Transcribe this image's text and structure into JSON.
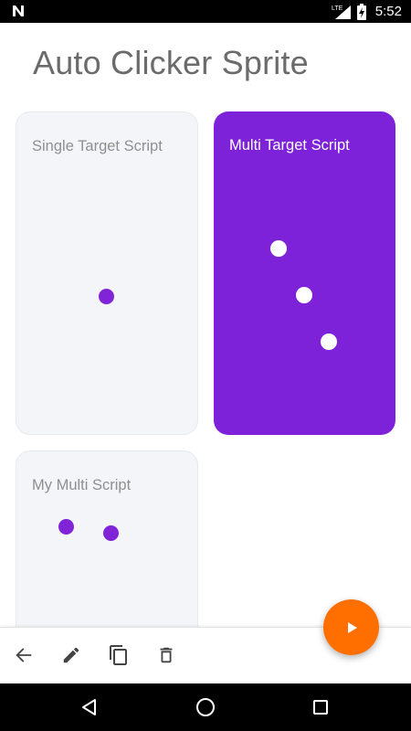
{
  "status_bar": {
    "time": "5:52",
    "network_label": "LTE",
    "icons": [
      "notification-n-icon",
      "lte-signal-icon",
      "battery-charging-icon"
    ]
  },
  "app": {
    "title": "Auto Clicker Sprite"
  },
  "scripts": [
    {
      "name": "Single Target Script",
      "selected": false,
      "target_count": 1
    },
    {
      "name": "Multi Target Script",
      "selected": true,
      "target_count": 3
    },
    {
      "name": "My Multi Script",
      "selected": false,
      "target_count": 2
    }
  ],
  "toolbar": {
    "icons": [
      "back-arrow-icon",
      "edit-pencil-icon",
      "copy-icon",
      "delete-trash-icon"
    ]
  },
  "fab": {
    "icon": "play-icon"
  },
  "nav": {
    "icons": [
      "back-triangle-icon",
      "home-circle-icon",
      "recents-square-icon"
    ]
  },
  "colors": {
    "accent_purple": "#7d22d9",
    "fab_orange": "#ff6f00",
    "card_light": "#f3f5f8",
    "title_gray": "#6b6b6b"
  }
}
